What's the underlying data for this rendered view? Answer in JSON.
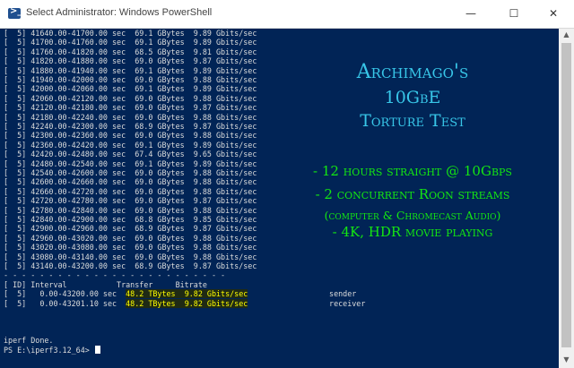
{
  "window": {
    "title": "Select Administrator: Windows PowerShell",
    "controls": {
      "minimize": "—",
      "maximize": "☐",
      "close": "✕"
    },
    "icon": "powershell-icon"
  },
  "console": {
    "lines": [
      "[  5] 41640.00-41700.00 sec  69.1 GBytes  9.89 Gbits/sec",
      "[  5] 41700.00-41760.00 sec  69.1 GBytes  9.89 Gbits/sec",
      "[  5] 41760.00-41820.00 sec  68.5 GBytes  9.81 Gbits/sec",
      "[  5] 41820.00-41880.00 sec  69.0 GBytes  9.87 Gbits/sec",
      "[  5] 41880.00-41940.00 sec  69.1 GBytes  9.89 Gbits/sec",
      "[  5] 41940.00-42000.00 sec  69.0 GBytes  9.88 Gbits/sec",
      "[  5] 42000.00-42060.00 sec  69.1 GBytes  9.89 Gbits/sec",
      "[  5] 42060.00-42120.00 sec  69.0 GBytes  9.88 Gbits/sec",
      "[  5] 42120.00-42180.00 sec  69.0 GBytes  9.87 Gbits/sec",
      "[  5] 42180.00-42240.00 sec  69.0 GBytes  9.88 Gbits/sec",
      "[  5] 42240.00-42300.00 sec  68.9 GBytes  9.87 Gbits/sec",
      "[  5] 42300.00-42360.00 sec  69.0 GBytes  9.88 Gbits/sec",
      "[  5] 42360.00-42420.00 sec  69.1 GBytes  9.89 Gbits/sec",
      "[  5] 42420.00-42480.00 sec  67.4 GBytes  9.65 Gbits/sec",
      "[  5] 42480.00-42540.00 sec  69.1 GBytes  9.89 Gbits/sec",
      "[  5] 42540.00-42600.00 sec  69.0 GBytes  9.88 Gbits/sec",
      "[  5] 42600.00-42660.00 sec  69.0 GBytes  9.88 Gbits/sec",
      "[  5] 42660.00-42720.00 sec  69.0 GBytes  9.88 Gbits/sec",
      "[  5] 42720.00-42780.00 sec  69.0 GBytes  9.87 Gbits/sec",
      "[  5] 42780.00-42840.00 sec  69.0 GBytes  9.88 Gbits/sec",
      "[  5] 42840.00-42900.00 sec  68.8 GBytes  9.85 Gbits/sec",
      "[  5] 42900.00-42960.00 sec  68.9 GBytes  9.87 Gbits/sec",
      "[  5] 42960.00-43020.00 sec  69.0 GBytes  9.88 Gbits/sec",
      "[  5] 43020.00-43080.00 sec  69.0 GBytes  9.88 Gbits/sec",
      "[  5] 43080.00-43140.00 sec  69.0 GBytes  9.88 Gbits/sec",
      "[  5] 43140.00-43200.00 sec  68.9 GBytes  9.87 Gbits/sec",
      "- - - - - - - - - - - - - - - - - - - - - - - - -",
      "[ ID] Interval           Transfer     Bitrate"
    ],
    "summary": [
      {
        "prefix": "[  5]   0.00-43200.00 sec  ",
        "highlight": "48.2 TBytes  9.82 Gbits/sec",
        "suffix": "                  sender"
      },
      {
        "prefix": "[  5]   0.00-43201.10 sec  ",
        "highlight": "48.2 TBytes  9.82 Gbits/sec",
        "suffix": "                  receiver"
      }
    ],
    "done": "iperf Done.",
    "prompt": "PS E:\\iperf3.12_64> "
  },
  "overlay": {
    "title": "Archimago's",
    "subtitle1": "10GbE",
    "subtitle2": "Torture Test",
    "bullet1": "- 12 hours straight @ 10Gbps",
    "bullet2": "- 2 concurrent Roon streams",
    "bullet2_sub": "(computer & Chromecast Audio)",
    "bullet3": "- 4K, HDR movie playing",
    "colors": {
      "title": "#38c6e8",
      "bullets": "#14e612"
    }
  },
  "colors": {
    "console_bg": "#012456",
    "console_text": "#dcdcdc",
    "highlight": "#ffff00"
  }
}
